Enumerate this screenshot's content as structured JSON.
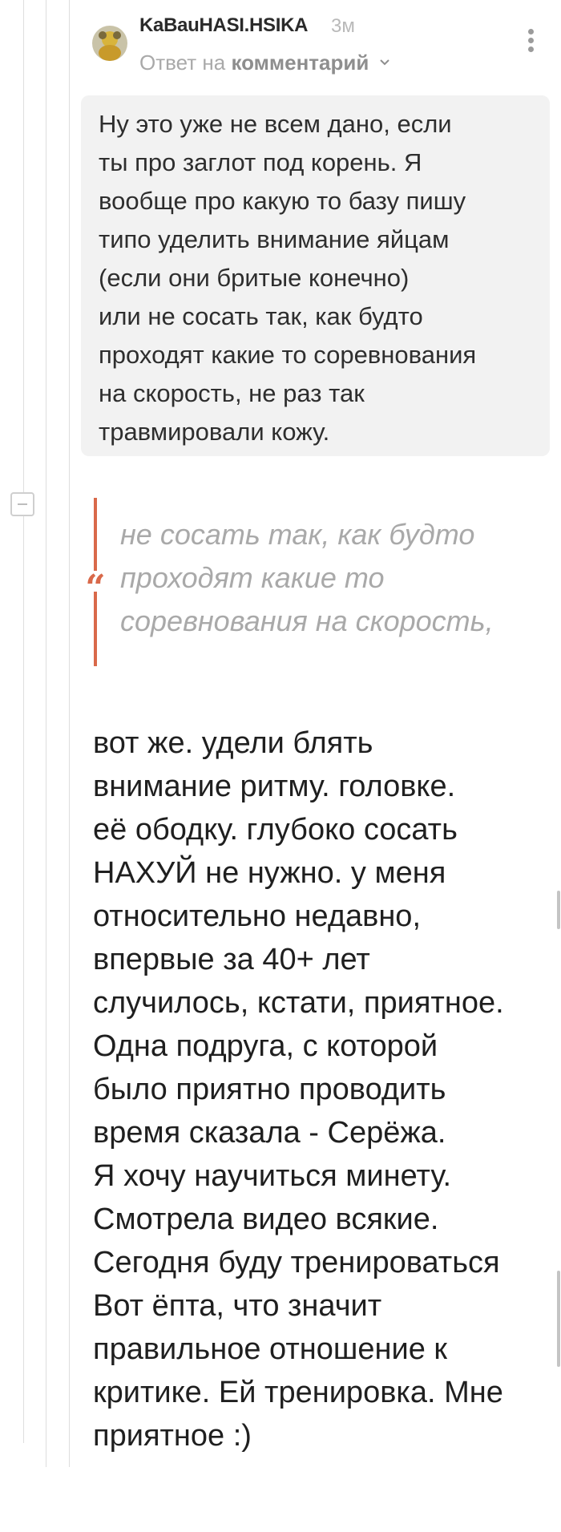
{
  "comment": {
    "author": "KaBauHASI.HSIKA",
    "time": "3м",
    "reply_prefix": "Ответ на",
    "reply_target": "комментарий"
  },
  "quoted_parent": {
    "text": "Ну это уже не всем дано, если\nты про заглот под корень. Я\nвообще про какую то базу пишу\nтипо уделить внимание яйцам\n(если они бритые конечно)\nили не сосать так, как будто\nпроходят какие то соревнования\nна скорость, не раз так\nтравмировали кожу."
  },
  "citation": {
    "text": "не сосать так, как будто\nпроходят какие то\nсоревнования на скорость,"
  },
  "body": {
    "text": "вот же. удели блять\nвнимание ритму. головке.\nеё ободку. глубоко сосать\nНАХУЙ не нужно. у меня\nотносительно недавно,\nвпервые за 40+ лет\nслучилось, кстати, приятное.\nОдна подруга, с которой\nбыло приятно проводить\nвремя сказала - Серёжа.\nЯ хочу научиться минету.\nСмотрела видео всякие.\nСегодня буду тренироваться\nВот ёпта, что значит\nправильное отношение к\nкритике. Ей тренировка. Мне\nприятное :)"
  },
  "icons": {
    "avatar": "avatar-image",
    "reply_chevron": "chevron-down-icon",
    "more": "more-vertical-icon",
    "collapse": "collapse-minus-icon",
    "quote": "quote-mark-icon"
  },
  "colors": {
    "accent": "#d9694a",
    "quote_bg": "#f2f2f2",
    "muted": "#a9a9a9"
  }
}
